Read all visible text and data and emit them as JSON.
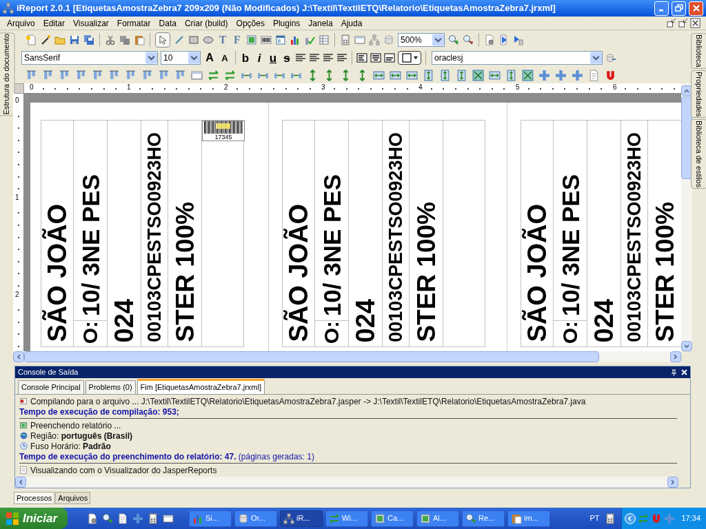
{
  "window": {
    "title": "iReport 2.0.1  [EtiquetasAmostraZebra7 209x209 (Não Modificados) J:\\Textil\\TextilETQ\\Relatorio\\EtiquetasAmostraZebra7.jrxml]"
  },
  "menu": [
    "Arquivo",
    "Editar",
    "Visualizar",
    "Formatar",
    "Data",
    "Criar (build)",
    "Opções",
    "Plugins",
    "Janela",
    "Ajuda"
  ],
  "left_panel_tabs": [
    "Estrutura do documento"
  ],
  "right_panel_tabs": [
    "Biblioteca",
    "Propriedades",
    "Biblioteca de estilos"
  ],
  "toolbar": {
    "tool_letters": [
      "T",
      "F"
    ],
    "zoom": "500%",
    "font": "SansSerif",
    "font_size": "10",
    "size_buttons": [
      "A",
      "A"
    ],
    "style_buttons": [
      "b",
      "i",
      "u",
      "s"
    ],
    "datasource": "oraclesj"
  },
  "ruler": {
    "marks": [
      "0",
      "1",
      "2",
      "3",
      "4",
      "5",
      "6"
    ],
    "side_marks": [
      "0",
      "1",
      "2"
    ]
  },
  "labels": [
    {
      "columns": [
        {
          "kind": "text",
          "text": "SÃO JOÃO"
        },
        {
          "kind": "text",
          "text": "10/ 3NE PES",
          "foot": "O:"
        },
        {
          "kind": "text",
          "text": "024"
        },
        {
          "kind": "text",
          "text": "00103CPESTSO0923HO"
        },
        {
          "kind": "text",
          "text": "STER 100%"
        },
        {
          "kind": "barcode",
          "caption": "17345"
        }
      ]
    },
    {
      "columns": [
        {
          "kind": "text",
          "text": "SÃO JOÃO"
        },
        {
          "kind": "text",
          "text": "10/ 3NE PES",
          "foot": "O:"
        },
        {
          "kind": "text",
          "text": "024"
        },
        {
          "kind": "text",
          "text": "00103CPESTSO0923HO"
        },
        {
          "kind": "text",
          "text": "STER 100%"
        },
        {
          "kind": "empty"
        }
      ]
    },
    {
      "columns": [
        {
          "kind": "text",
          "text": "SÃO JOÃO"
        },
        {
          "kind": "text",
          "text": "10/ 3NE PES",
          "foot": "O:"
        },
        {
          "kind": "text",
          "text": "024"
        },
        {
          "kind": "text",
          "text": "00103CPESTSO0923HO"
        },
        {
          "kind": "text",
          "text": "STER 100%"
        }
      ]
    }
  ],
  "console": {
    "title": "Console de Saída",
    "tabs": [
      {
        "label": "Console Principal",
        "selected": false
      },
      {
        "label": "Problems (0)",
        "selected": false
      },
      {
        "label": "Fim [EtiquetasAmostraZebra7.jrxml]",
        "selected": true
      }
    ],
    "lines": [
      {
        "kind": "message",
        "text": "Compilando para o arquivo ... J:\\Textil\\TextilETQ\\Relatorio\\EtiquetasAmostraZebra7.jasper -> J:\\Textil\\TextilETQ\\Relatorio\\EtiquetasAmostraZebra7.java"
      },
      {
        "kind": "heading",
        "text": "Tempo de execução de compilação: 953;"
      },
      {
        "kind": "message",
        "text": "Preenchendo relatório ..."
      },
      {
        "kind": "message",
        "text": "Região: **português (Brasil)**"
      },
      {
        "kind": "message",
        "text": "Fuso Horário: **Padrão**"
      },
      {
        "kind": "status",
        "text": "**Tempo de execução do preenchimento do relatório: 47.** (páginas geradas: 1)"
      },
      {
        "kind": "message",
        "text": "Visualizando com o Visualizador do JasperReports"
      }
    ]
  },
  "bottom_tabs": [
    {
      "label": "Processos",
      "selected": true
    },
    {
      "label": "Arquivos",
      "selected": false
    }
  ],
  "taskbar": {
    "start": "Iniciar",
    "tasks": [
      {
        "label": "Si...",
        "selected": false
      },
      {
        "label": "Or...",
        "selected": false
      },
      {
        "label": "iR...",
        "selected": true
      },
      {
        "label": "Wi...",
        "selected": false
      },
      {
        "label": "Ca...",
        "selected": false
      },
      {
        "label": "Al...",
        "selected": false
      },
      {
        "label": "Re...",
        "selected": false
      },
      {
        "label": "im...",
        "selected": false
      }
    ],
    "language": "PT",
    "clock": "17:34"
  }
}
